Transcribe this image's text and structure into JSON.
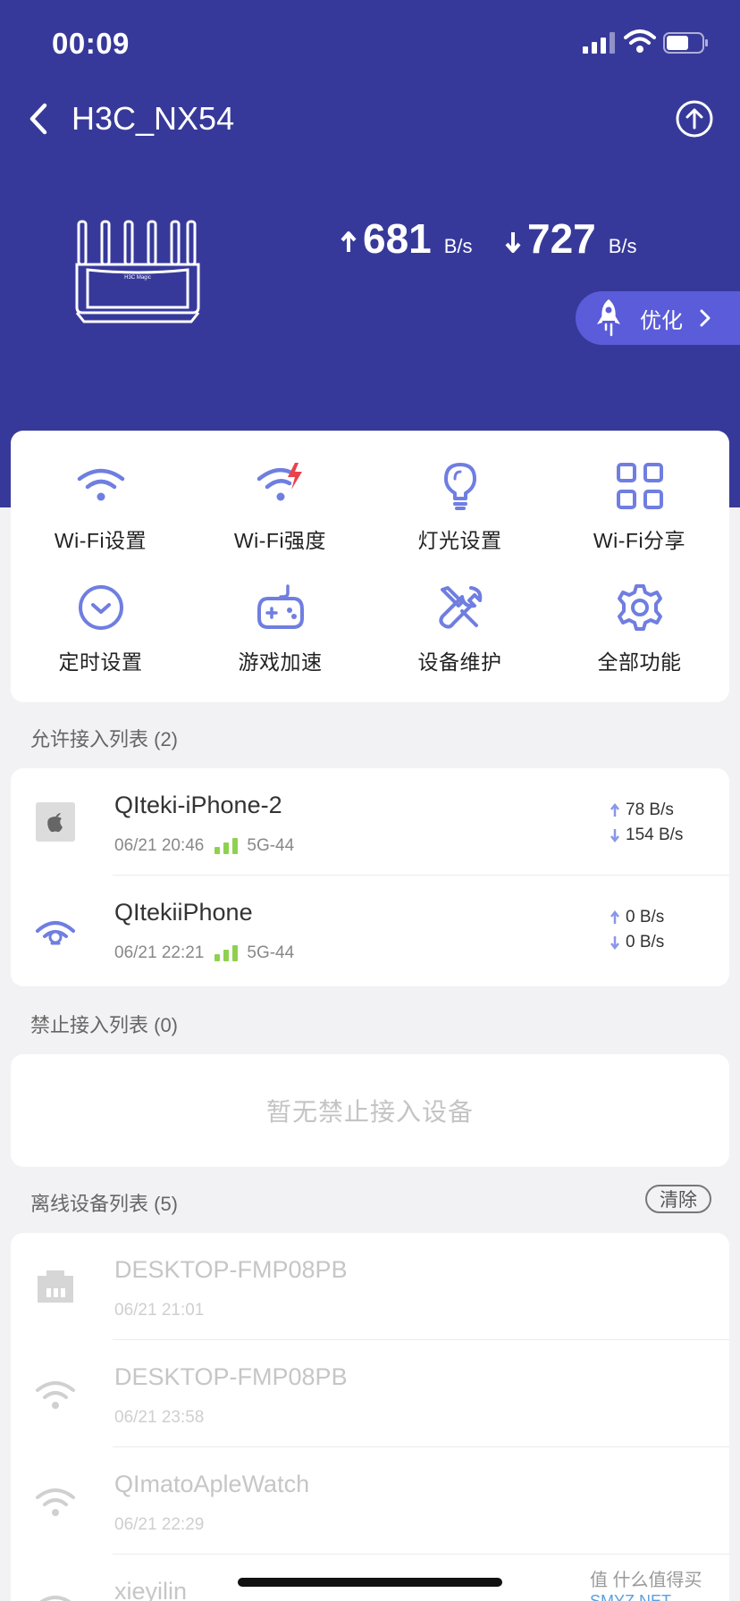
{
  "status": {
    "time": "00:09"
  },
  "nav": {
    "title": "H3C_NX54"
  },
  "router": {
    "brand_label": "H3C Magic"
  },
  "speed": {
    "upload": {
      "value": "681",
      "unit": "B/s"
    },
    "download": {
      "value": "727",
      "unit": "B/s"
    }
  },
  "optimize": {
    "label": "优化"
  },
  "functions": [
    {
      "label": "Wi-Fi设置",
      "icon": "wifi-icon"
    },
    {
      "label": "Wi-Fi强度",
      "icon": "wifi-strength-icon"
    },
    {
      "label": "灯光设置",
      "icon": "light-bulb-icon"
    },
    {
      "label": "Wi-Fi分享",
      "icon": "qr-code-icon"
    },
    {
      "label": "定时设置",
      "icon": "timer-icon"
    },
    {
      "label": "游戏加速",
      "icon": "gamepad-icon"
    },
    {
      "label": "设备维护",
      "icon": "tools-icon"
    },
    {
      "label": "全部功能",
      "icon": "gear-icon"
    }
  ],
  "allowed": {
    "title": "允许接入列表 (2)",
    "devices": [
      {
        "name": "QIteki-iPhone-2",
        "time": "06/21 20:46",
        "band": "5G-44",
        "up": "78 B/s",
        "down": "154 B/s",
        "icon": "apple-icon"
      },
      {
        "name": "QItekiiPhone",
        "time": "06/21 22:21",
        "band": "5G-44",
        "up": "0 B/s",
        "down": "0 B/s",
        "icon": "wireless-device-icon"
      }
    ]
  },
  "blocked": {
    "title": "禁止接入列表 (0)",
    "empty_text": "暂无禁止接入设备"
  },
  "offline": {
    "title": "离线设备列表 (5)",
    "clear_label": "清除",
    "devices": [
      {
        "name": "DESKTOP-FMP08PB",
        "time": "06/21 21:01",
        "icon": "ethernet-icon"
      },
      {
        "name": "DESKTOP-FMP08PB",
        "time": "06/21 23:58",
        "icon": "wifi-icon"
      },
      {
        "name": "QImatoApleWatch",
        "time": "06/21 22:29",
        "icon": "wifi-icon"
      },
      {
        "name": "xieyilin",
        "time": "",
        "icon": "wifi-icon"
      }
    ]
  },
  "watermark": {
    "text": "值 什么值得买",
    "site": "SMYZ.NET"
  },
  "colors": {
    "header": "#37399a",
    "accent": "#6f7ee0",
    "signal": "#8fd14f",
    "optimize": "#5b5cd9"
  }
}
